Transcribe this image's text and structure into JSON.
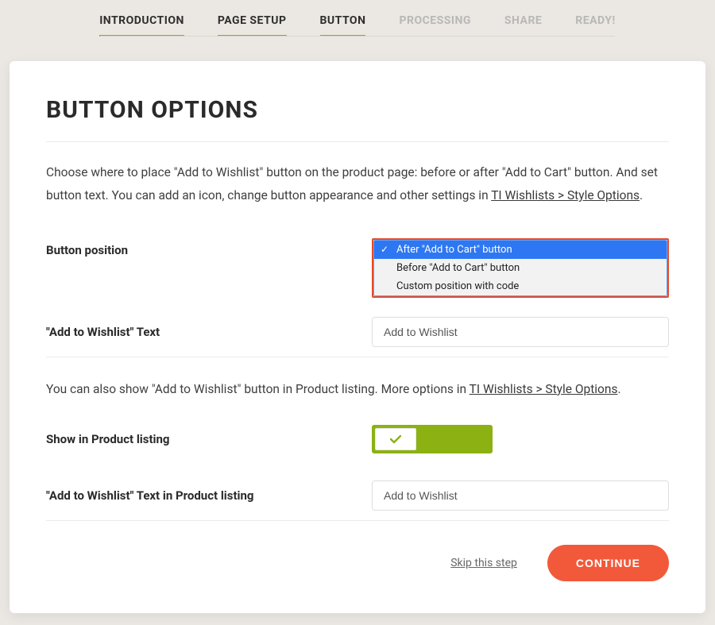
{
  "tabs": {
    "items": [
      {
        "label": "INTRODUCTION",
        "state": "done"
      },
      {
        "label": "PAGE SETUP",
        "state": "done"
      },
      {
        "label": "BUTTON",
        "state": "active"
      },
      {
        "label": "PROCESSING",
        "state": "disabled"
      },
      {
        "label": "SHARE",
        "state": "disabled"
      },
      {
        "label": "READY!",
        "state": "disabled"
      }
    ]
  },
  "page": {
    "title": "BUTTON OPTIONS",
    "intro_pre": "Choose where to place \"Add to Wishlist\" button on the product page: before or after \"Add to Cart\" button. And set button text. You can add an icon, change button appearance and other settings in ",
    "intro_link": "TI Wishlists > Style Options",
    "intro_post": ".",
    "intro2_pre": "You can also show \"Add to Wishlist\" button in Product listing. More options in ",
    "intro2_link": "TI Wishlists > Style Options",
    "intro2_post": "."
  },
  "fields": {
    "position": {
      "label": "Button position",
      "selected": "After \"Add to Cart\" button",
      "options": [
        "After \"Add to Cart\" button",
        "Before \"Add to Cart\" button",
        "Custom position with code"
      ]
    },
    "text": {
      "label": "\"Add to Wishlist\" Text",
      "value": "Add to Wishlist"
    },
    "show_listing": {
      "label": "Show in Product listing",
      "on": true
    },
    "listing_text": {
      "label": "\"Add to Wishlist\" Text in Product listing",
      "value": "Add to Wishlist"
    }
  },
  "actions": {
    "skip": "Skip this step",
    "continue": "CONTINUE"
  },
  "colors": {
    "accent_green": "#8cb113",
    "accent_orange": "#f1593a",
    "highlight_red": "#e44b2a",
    "select_blue": "#2e77f2"
  }
}
